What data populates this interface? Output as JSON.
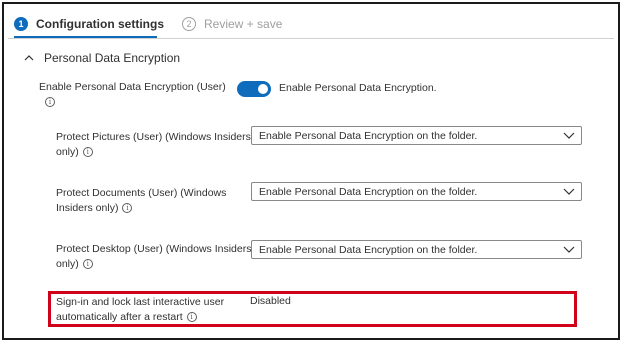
{
  "wizard": {
    "steps": [
      {
        "number": "1",
        "label": "Configuration settings"
      },
      {
        "number": "2",
        "label": "Review + save"
      }
    ]
  },
  "section": {
    "title": "Personal Data Encryption"
  },
  "settings": {
    "enable_pde": {
      "label": "Enable Personal Data Encryption (User)",
      "toggle_text": "Enable Personal Data Encryption.",
      "toggle_state": "on"
    },
    "protect_pictures": {
      "label_line1": "Protect Pictures (User) (Windows Insiders",
      "label_line2": "only)",
      "value": "Enable Personal Data Encryption on the folder."
    },
    "protect_documents": {
      "label_line1": "Protect Documents (User) (Windows",
      "label_line2": "Insiders only)",
      "value": "Enable Personal Data Encryption on the folder."
    },
    "protect_desktop": {
      "label_line1": "Protect Desktop (User) (Windows Insiders",
      "label_line2": "only)",
      "value": "Enable Personal Data Encryption on the folder."
    },
    "sign_in_lock": {
      "label_line1": "Sign-in and lock last interactive user",
      "label_line2": "automatically after a restart",
      "value": "Disabled"
    }
  },
  "icons": {
    "info": "info-icon",
    "chevron_up": "chevron-up-icon",
    "chevron_down": "chevron-down-icon"
  },
  "colors": {
    "accent": "#0f6cbd",
    "highlight": "#d0021b",
    "inactive": "#a19f9d"
  }
}
